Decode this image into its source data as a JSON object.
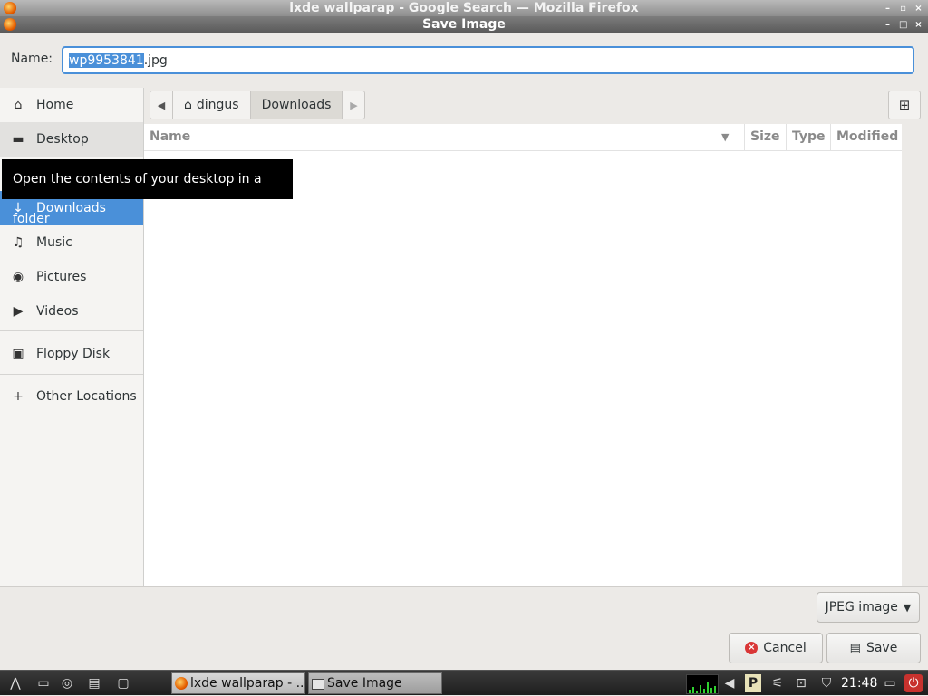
{
  "window_back": {
    "title": "lxde wallparap - Google Search — Mozilla Firefox"
  },
  "dialog": {
    "title": "Save Image",
    "name_label": "Name:",
    "filename_selected": "wp9953841",
    "filename_ext": ".jpg",
    "sidebar": [
      {
        "id": "home",
        "label": "Home",
        "icon": "home-icon",
        "state": "normal"
      },
      {
        "id": "desktop",
        "label": "Desktop",
        "icon": "folder-icon",
        "state": "hover"
      },
      {
        "id": "downloads",
        "label": "Downloads",
        "icon": "download-icon",
        "state": "selected"
      },
      {
        "id": "music",
        "label": "Music",
        "icon": "music-icon",
        "state": "normal"
      },
      {
        "id": "pictures",
        "label": "Pictures",
        "icon": "camera-icon",
        "state": "normal"
      },
      {
        "id": "videos",
        "label": "Videos",
        "icon": "video-icon",
        "state": "normal"
      },
      {
        "id": "floppy",
        "label": "Floppy Disk",
        "icon": "floppy-disk-icon",
        "state": "normal"
      },
      {
        "id": "other",
        "label": "Other Locations",
        "icon": "plus-icon",
        "state": "normal"
      }
    ],
    "tooltip": "Open the contents of your desktop in a folder",
    "path": {
      "home_segment": "dingus",
      "current_segment": "Downloads"
    },
    "columns": {
      "name": "Name",
      "size": "Size",
      "type": "Type",
      "modified": "Modified"
    },
    "file_type": "JPEG image",
    "buttons": {
      "cancel": "Cancel",
      "save": "Save"
    }
  },
  "taskbar": {
    "tasks": [
      {
        "label": "lxde wallparap - ...",
        "icon": "firefox-icon"
      },
      {
        "label": "Save Image",
        "icon": "window-icon"
      }
    ],
    "clock": "21:48"
  },
  "colors": {
    "accent": "#4a90d9",
    "tooltip_bg": "#000000",
    "taskbar_bg": "#2a2a2a"
  }
}
